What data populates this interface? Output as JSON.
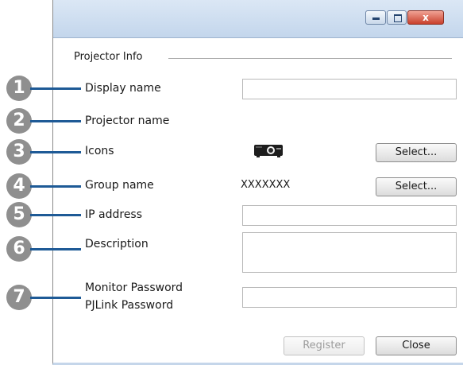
{
  "window": {
    "minimize_glyph": "",
    "maximize_glyph": "",
    "close_glyph": "x"
  },
  "group": {
    "title": "Projector Info"
  },
  "fields": {
    "display_name_label": "Display name",
    "projector_name_label": "Projector name",
    "icons_label": "Icons",
    "group_name_label": "Group name",
    "group_name_value": "XXXXXXX",
    "ip_address_label": "IP address",
    "description_label": "Description",
    "monitor_password_label": "Monitor Password",
    "pjlink_password_label": "PJLink Password",
    "display_name_value": "",
    "ip_address_value": "",
    "description_value": "",
    "password_value": ""
  },
  "buttons": {
    "select_icon": "Select...",
    "select_group": "Select...",
    "register": "Register",
    "close": "Close"
  },
  "callouts": [
    "1",
    "2",
    "3",
    "4",
    "5",
    "6",
    "7"
  ],
  "colors": {
    "callout": "#8f8f8f",
    "leader": "#1e5a96",
    "close_button": "#c9402c"
  }
}
